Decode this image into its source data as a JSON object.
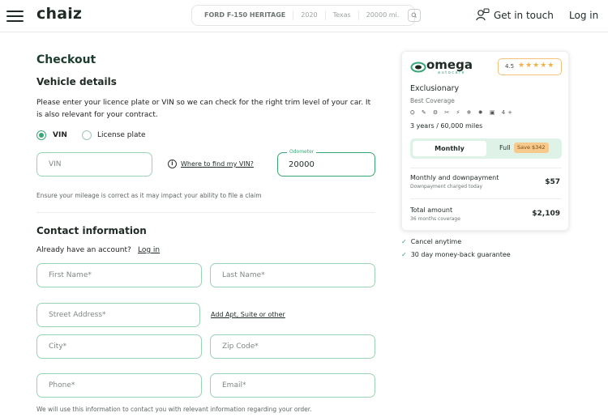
{
  "header": {
    "logo": "chaiz",
    "vehicle": {
      "model": "FORD F-150 HERITAGE",
      "year": "2020",
      "state": "Texas",
      "miles": "20000 mi."
    },
    "get_in_touch": "Get in touch",
    "login": "Log in"
  },
  "checkout": {
    "title": "Checkout",
    "vehicle_details": {
      "title": "Vehicle details",
      "description": "Please enter your licence plate or VIN so we can check for the right trim level of your car. It is also relevant for your contract.",
      "radio_vin": "VIN",
      "radio_plate": "License plate",
      "vin_placeholder": "VIN",
      "where_vin_link": "Where to find my VIN?",
      "odometer_label": "Odometer",
      "odometer_value": "20000",
      "mileage_note": "Ensure your mileage is correct as it may impact your ability to file a claim"
    },
    "contact": {
      "title": "Contact information",
      "have_account": "Already have an account?",
      "login_link": "Log in",
      "first_name": "First Name*",
      "last_name": "Last Name*",
      "street": "Street Address*",
      "add_apt": "Add Apt, Suite or other",
      "city": "City*",
      "zip": "Zip Code*",
      "phone": "Phone*",
      "email": "Email*",
      "contact_note": "We will use this information to contact you with relevant information regarding your order."
    }
  },
  "plan_card": {
    "provider": "omega",
    "provider_sub": "autocare",
    "rating": "4.5",
    "stars": "★★★★★",
    "plan_name": "Exclusionary",
    "plan_sub": "Best Coverage",
    "feature_icons": "⛭ ✎ ⚙ ✂ ⚡ ❄ ✹ ▣ 4+",
    "term": "3 years / 60,000 miles",
    "toggle_monthly": "Monthly",
    "toggle_full": "Full",
    "save_badge": "Save $342",
    "monthly_title": "Monthly and downpayment",
    "monthly_sub": "Downpayment charged today",
    "monthly_price": "$57",
    "total_title": "Total amount",
    "total_sub": "36 months coverage",
    "total_price": "$2,109"
  },
  "guarantees": [
    "Cancel anytime",
    "30 day money-back guarantee"
  ],
  "colors": {
    "accent": "#3aa676",
    "field_border": "#9bd3b6",
    "save_badge": "#f7c98d"
  }
}
